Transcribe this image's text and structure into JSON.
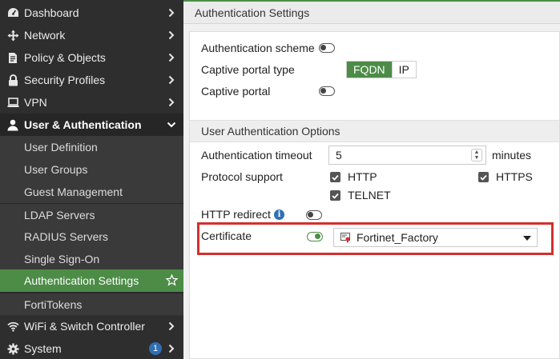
{
  "sidebar": {
    "items": [
      {
        "label": "Dashboard",
        "icon": "dashboard-icon"
      },
      {
        "label": "Network",
        "icon": "network-icon"
      },
      {
        "label": "Policy & Objects",
        "icon": "policy-icon"
      },
      {
        "label": "Security Profiles",
        "icon": "lock-icon"
      },
      {
        "label": "VPN",
        "icon": "vpn-icon"
      },
      {
        "label": "User & Authentication",
        "icon": "user-icon"
      },
      {
        "label": "User Definition"
      },
      {
        "label": "User Groups"
      },
      {
        "label": "Guest Management"
      },
      {
        "label": "LDAP Servers"
      },
      {
        "label": "RADIUS Servers"
      },
      {
        "label": "Single Sign-On"
      },
      {
        "label": "Authentication Settings"
      },
      {
        "label": "FortiTokens"
      },
      {
        "label": "WiFi & Switch Controller",
        "icon": "wifi-icon"
      },
      {
        "label": "System",
        "icon": "gear-icon",
        "badge": "1"
      }
    ]
  },
  "page": {
    "title": "Authentication Settings"
  },
  "form": {
    "auth_scheme_label": "Authentication scheme",
    "auth_scheme_enabled": false,
    "captive_portal_type_label": "Captive portal type",
    "captive_portal_type_options": [
      "FQDN",
      "IP"
    ],
    "captive_portal_type_selected": "FQDN",
    "captive_portal_label": "Captive portal",
    "captive_portal_enabled": false,
    "section_title": "User Authentication Options",
    "timeout_label": "Authentication timeout",
    "timeout_value": "5",
    "timeout_unit": "minutes",
    "protocol_label": "Protocol support",
    "protocols": [
      {
        "label": "HTTP",
        "checked": true
      },
      {
        "label": "HTTPS",
        "checked": true
      },
      {
        "label": "TELNET",
        "checked": true
      }
    ],
    "http_redirect_label": "HTTP redirect",
    "http_redirect_enabled": false,
    "certificate_label": "Certificate",
    "certificate_enabled": true,
    "certificate_value": "Fortinet_Factory"
  },
  "colors": {
    "accent": "#4c8c47",
    "highlight": "#d32f2f",
    "sidebar_bg": "#2e2e2e",
    "badge": "#2f6fb5"
  }
}
